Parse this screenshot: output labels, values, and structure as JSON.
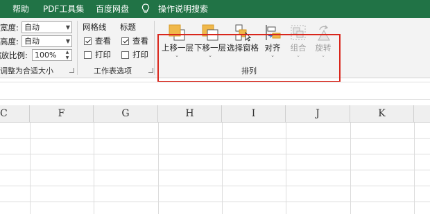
{
  "menubar": {
    "items": [
      "帮助",
      "PDF工具集",
      "百度网盘",
      "操作说明搜索"
    ],
    "bulb_icon": "lightbulb-icon",
    "bg_color": "#217346"
  },
  "scale": {
    "width_label": "宽度:",
    "width_value": "自动",
    "height_label": "高度:",
    "height_value": "自动",
    "zoom_label": "缩放比例:",
    "zoom_value": "100%",
    "group_label": "调整为合适大小"
  },
  "sheet_options": {
    "gridlines_title": "网格线",
    "headings_title": "标题",
    "view_label": "查看",
    "print_label": "打印",
    "gridlines_view_checked": true,
    "gridlines_print_checked": false,
    "headings_view_checked": true,
    "headings_print_checked": false,
    "group_label": "工作表选项"
  },
  "arrange": {
    "buttons": [
      {
        "label": "上移一层",
        "icon": "bring-forward-icon",
        "dropdown": true,
        "enabled": true
      },
      {
        "label": "下移一层",
        "icon": "send-backward-icon",
        "dropdown": true,
        "enabled": true
      },
      {
        "label": "选择窗格",
        "icon": "selection-pane-icon",
        "dropdown": false,
        "enabled": true
      },
      {
        "label": "对齐",
        "icon": "align-icon",
        "dropdown": true,
        "enabled": true
      },
      {
        "label": "组合",
        "icon": "group-objects-icon",
        "dropdown": true,
        "enabled": false
      },
      {
        "label": "旋转",
        "icon": "rotate-icon",
        "dropdown": true,
        "enabled": false
      }
    ],
    "group_label": "排列",
    "highlight_color": "#d9261c"
  },
  "columns": [
    "C",
    "F",
    "G",
    "H",
    "I",
    "J",
    "K"
  ]
}
